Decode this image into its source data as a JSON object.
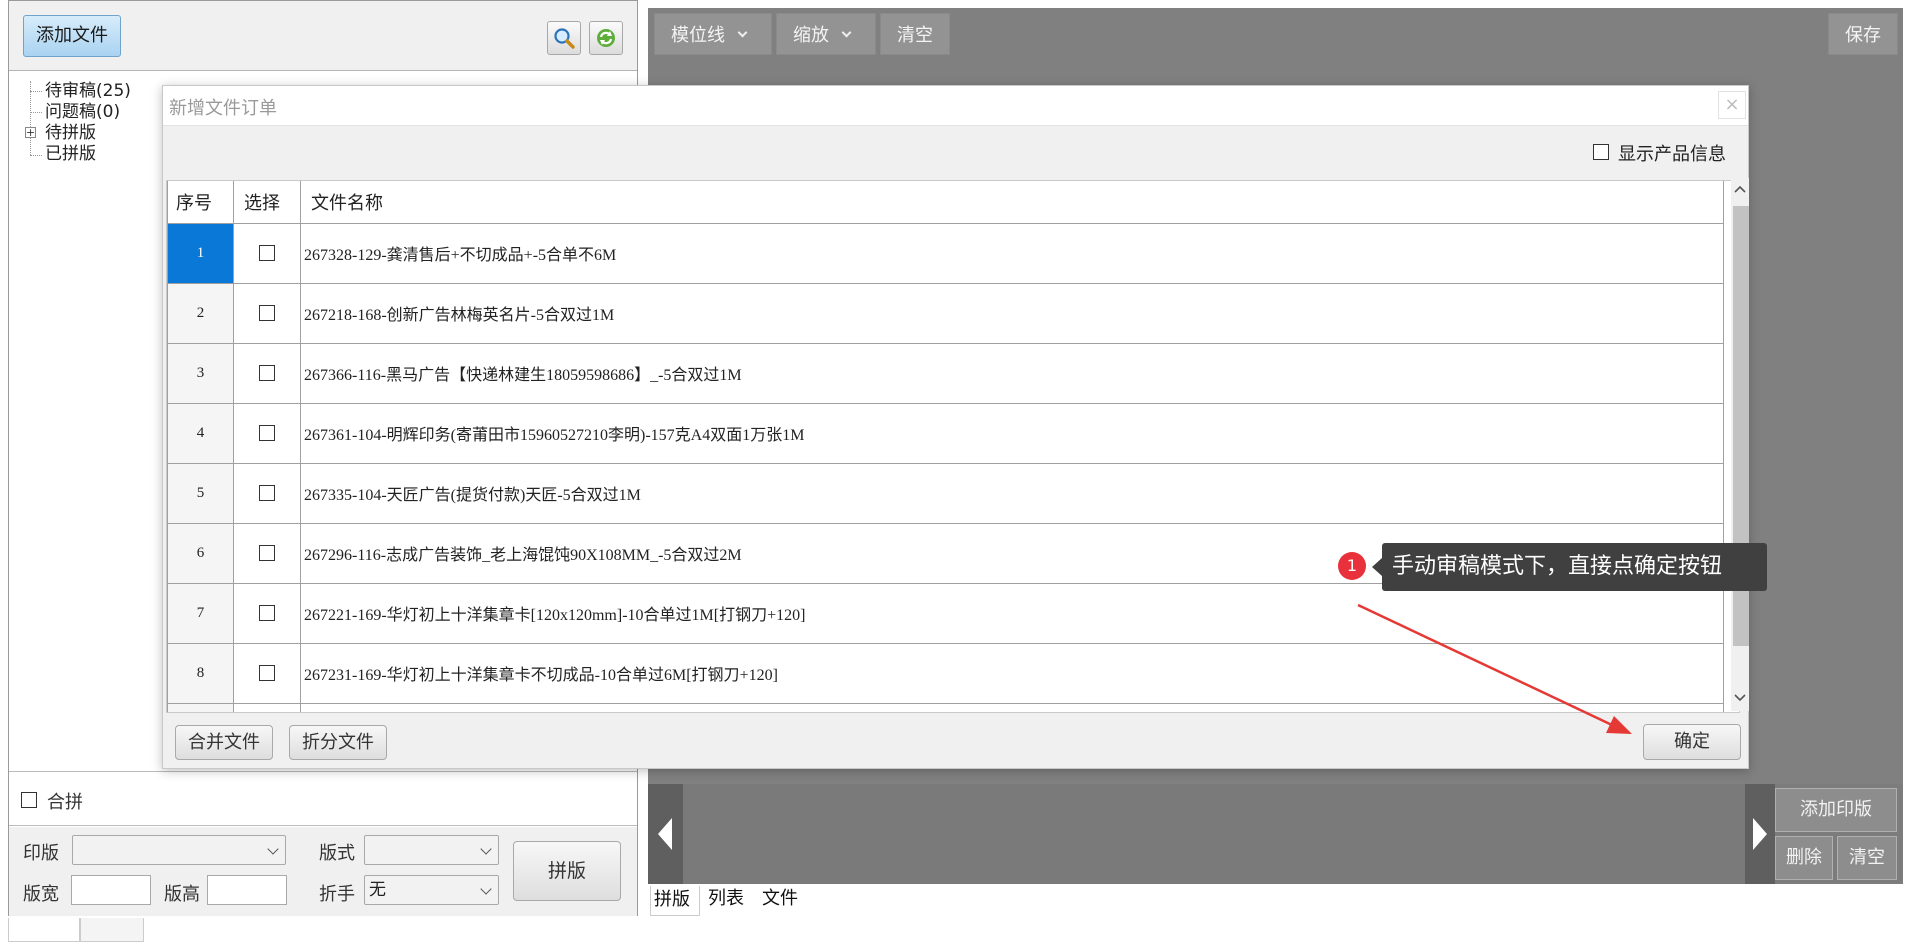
{
  "left_panel": {
    "add_file_label": "添加文件",
    "tree": [
      {
        "label": "待审稿(25)",
        "expandable": false
      },
      {
        "label": "问题稿(0)",
        "expandable": false
      },
      {
        "label": "待拼版",
        "expandable": true
      },
      {
        "label": "已拼版",
        "expandable": false
      }
    ],
    "merge_checkbox_label": "合拼",
    "form": {
      "plate_label": "印版",
      "plate_value": "",
      "layout_label": "版式",
      "layout_value": "",
      "width_label": "版宽",
      "width_value": "",
      "height_label": "版高",
      "height_value": "",
      "fold_label": "折手",
      "fold_value": "无",
      "impose_button": "拼版"
    }
  },
  "right_panel": {
    "toolbar": {
      "guide_lines": "模位线",
      "zoom": "缩放",
      "clear": "清空",
      "save": "保存"
    },
    "side_buttons": {
      "add_plate": "添加印版",
      "delete": "删除",
      "clear": "清空"
    },
    "bottom_tabs": [
      "拼版",
      "列表",
      "文件"
    ]
  },
  "dialog": {
    "title": "新增文件订单",
    "close_symbol": "×",
    "show_product_info_label": "显示产品信息",
    "columns": [
      "序号",
      "选择",
      "文件名称"
    ],
    "rows": [
      {
        "seq": "1",
        "name": "267328-129-龚清售后+不切成品+-5合单不6M",
        "selected": true
      },
      {
        "seq": "2",
        "name": "267218-168-创新广告林梅英名片-5合双过1M",
        "selected": false
      },
      {
        "seq": "3",
        "name": "267366-116-黑马广告【快递林建生18059598686】_-5合双过1M",
        "selected": false
      },
      {
        "seq": "4",
        "name": "267361-104-明辉印务(寄莆田市15960527210李明)-157克A4双面1万张1M",
        "selected": false
      },
      {
        "seq": "5",
        "name": "267335-104-天匠广告(提货付款)天匠-5合双过1M",
        "selected": false
      },
      {
        "seq": "6",
        "name": "267296-116-志成广告装饰_老上海馄饨90X108MM_-5合双过2M",
        "selected": false
      },
      {
        "seq": "7",
        "name": "267221-169-华灯初上十洋集章卡[120x120mm]-10合单过1M[打钢刀+120]",
        "selected": false
      },
      {
        "seq": "8",
        "name": "267231-169-华灯初上十洋集章卡不切成品-10合单过6M[打钢刀+120]",
        "selected": false
      }
    ],
    "merge_files_button": "合并文件",
    "split_files_button": "折分文件",
    "confirm_button": "确定"
  },
  "annotation": {
    "step_number": "1",
    "text": "手动审稿模式下，直接点确定按钮",
    "badge_color": "#e8313a",
    "arrow_color": "#e53935"
  },
  "colors": {
    "selected_row": "#0a78d7",
    "workspace_gray": "#808080"
  }
}
